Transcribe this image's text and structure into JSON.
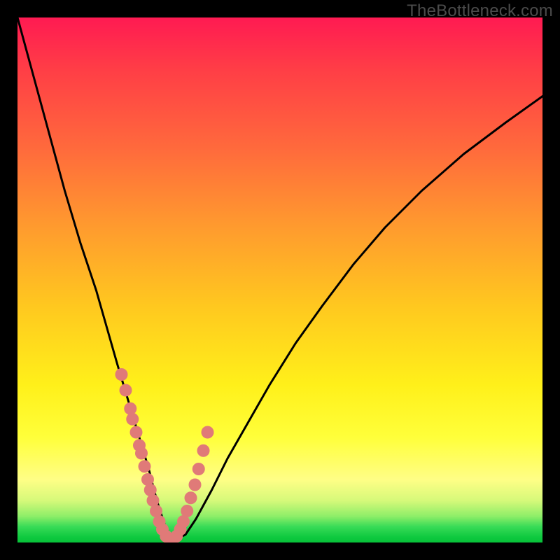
{
  "watermark": {
    "text": "TheBottleneck.com"
  },
  "chart_data": {
    "type": "line",
    "title": "",
    "xlabel": "",
    "ylabel": "",
    "xlim": [
      0,
      100
    ],
    "ylim": [
      0,
      100
    ],
    "series": [
      {
        "name": "bottleneck-curve",
        "x": [
          0,
          3,
          6,
          9,
          12,
          15,
          17,
          19,
          20.5,
          22,
          23.5,
          25,
          26,
          27,
          28,
          29,
          30,
          32,
          34,
          37,
          40,
          44,
          48,
          53,
          58,
          64,
          70,
          77,
          85,
          93,
          100
        ],
        "values": [
          100,
          89,
          78,
          67,
          57,
          48,
          41,
          34,
          29,
          24,
          19,
          14,
          10,
          6.5,
          3.5,
          1.5,
          0.5,
          1.5,
          4.5,
          10,
          16,
          23,
          30,
          38,
          45,
          53,
          60,
          67,
          74,
          80,
          85
        ]
      }
    ],
    "scatter_points": {
      "name": "sample-points",
      "color": "#e07a78",
      "x": [
        19.8,
        20.6,
        21.5,
        21.9,
        22.6,
        23.2,
        23.6,
        24.2,
        24.8,
        25.3,
        25.8,
        26.4,
        27.0,
        27.6,
        28.3,
        29.0,
        29.6,
        30.3,
        31.0,
        31.6,
        32.3,
        33.0,
        33.8,
        34.5,
        35.4,
        36.2
      ],
      "y": [
        32.0,
        29.0,
        25.5,
        23.5,
        21.0,
        18.5,
        17.0,
        14.5,
        12.0,
        10.0,
        8.0,
        6.0,
        4.0,
        2.5,
        1.2,
        0.6,
        0.6,
        1.2,
        2.5,
        4.0,
        6.0,
        8.5,
        11.0,
        14.0,
        17.5,
        21.0
      ]
    }
  }
}
